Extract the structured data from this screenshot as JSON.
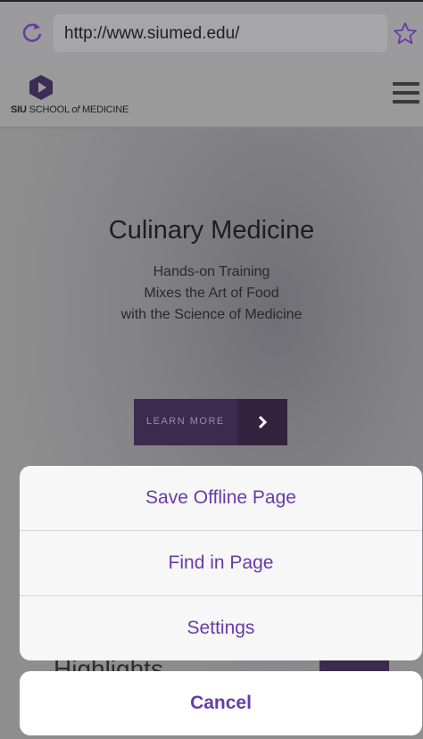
{
  "browser": {
    "url": "http://www.siumed.edu/",
    "reload_icon": "reload-icon",
    "bookmark_icon": "star-icon"
  },
  "site": {
    "logo_bold": "SIU",
    "logo_rest": "SCHOOL",
    "logo_of": "of",
    "logo_end": "MEDICINE",
    "menu_icon": "hamburger-menu-icon"
  },
  "hero": {
    "title": "Culinary Medicine",
    "subtitle_lines": [
      "Hands-on Training",
      "Mixes the Art of Food",
      "with the Science of Medicine"
    ],
    "learn_more_label": "LEARN MORE",
    "highlights_partial": "Highlights"
  },
  "action_sheet": {
    "items": [
      "Save Offline Page",
      "Find in Page",
      "Settings"
    ],
    "cancel_label": "Cancel",
    "accent_color": "#6a3aa8"
  }
}
